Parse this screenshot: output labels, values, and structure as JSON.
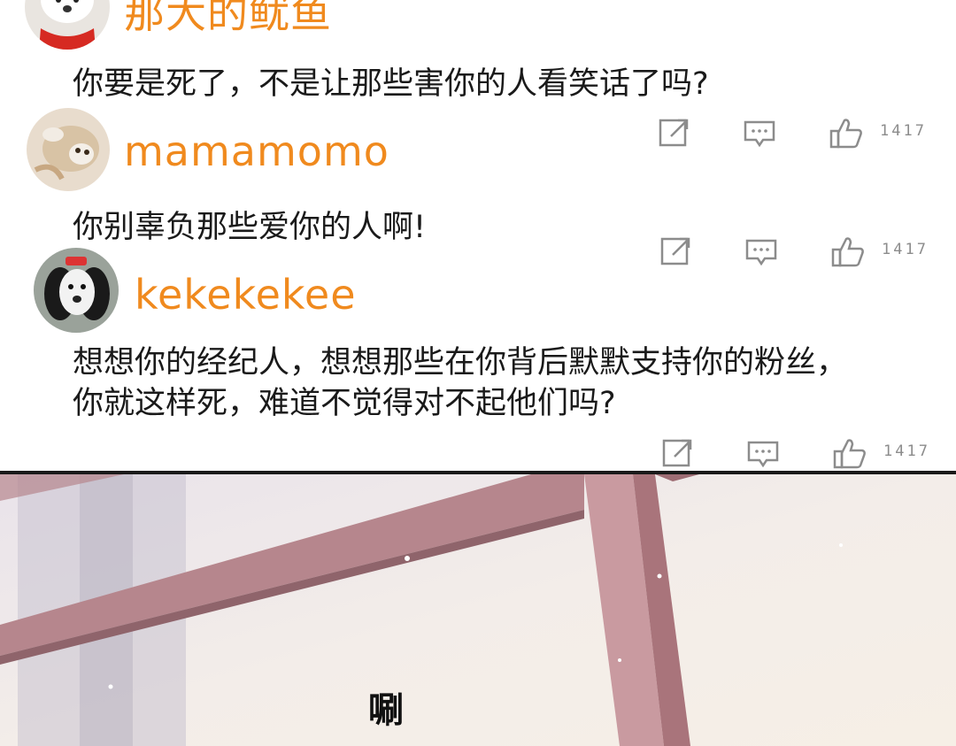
{
  "comments": [
    {
      "username": "那大的鱿鱼",
      "text_lines": [
        "你要是死了，不是让那些害你的人看笑话了吗?"
      ],
      "likes": "1417"
    },
    {
      "username": "mamamomo",
      "text_lines": [
        "你别辜负那些爱你的人啊!"
      ],
      "likes": "1417"
    },
    {
      "username": "kekekekee",
      "text_lines": [
        "想想你的经纪人，想想那些在你背后默默支持你的粉丝，",
        "你就这样死，难道不觉得对不起他们吗?"
      ],
      "likes": "1417"
    }
  ],
  "icons": {
    "share": "share-icon",
    "comment": "comment-icon",
    "like": "thumbs-up-icon"
  },
  "scene": {
    "sound_effect": "唰"
  },
  "colors": {
    "username": "#f08a1e",
    "text": "#1a1a1a",
    "icon": "#8c8c8c",
    "divider": "#1a1a1a"
  }
}
